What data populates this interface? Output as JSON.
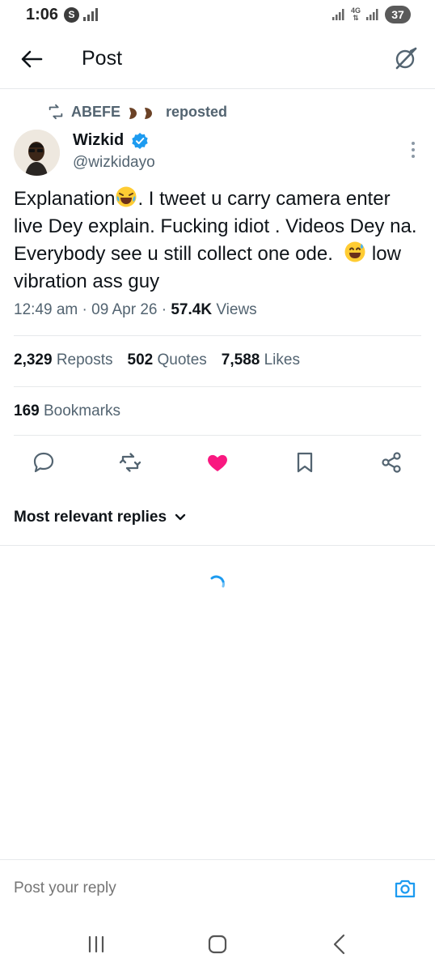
{
  "status_bar": {
    "time": "1:06",
    "app_badge": "S",
    "battery": "37",
    "network": "4G"
  },
  "header": {
    "title": "Post"
  },
  "repost": {
    "user": "ABEFE",
    "label": "reposted"
  },
  "author": {
    "name": "Wizkid",
    "handle": "@wizkidayo"
  },
  "tweet": {
    "part1": "Explanation",
    "part2": ". I tweet u carry camera enter live Dey explain. Fucking idiot . Videos Dey na. Everybody see u still collect one ode.  ",
    "part3": " low vibration ass guy"
  },
  "meta": {
    "time": "12:49 am",
    "sep1": " · ",
    "date": "09 Apr 26",
    "sep2": " · ",
    "views_count": "57.4K",
    "views_label": " Views"
  },
  "stats": {
    "reposts_count": "2,329",
    "reposts_label": "Reposts",
    "quotes_count": "502",
    "quotes_label": "Quotes",
    "likes_count": "7,588",
    "likes_label": "Likes",
    "bookmarks_count": "169",
    "bookmarks_label": "Bookmarks"
  },
  "actions": [
    "reply-icon",
    "repost-icon",
    "like-icon",
    "bookmark-icon",
    "share-icon"
  ],
  "colors": {
    "like_active": "#f91880",
    "verified": "#1d9bf0",
    "secondary_text": "#536471",
    "camera": "#1d9bf0"
  },
  "replies": {
    "sort_label": "Most relevant replies"
  },
  "reply_bar": {
    "placeholder": "Post your reply"
  }
}
